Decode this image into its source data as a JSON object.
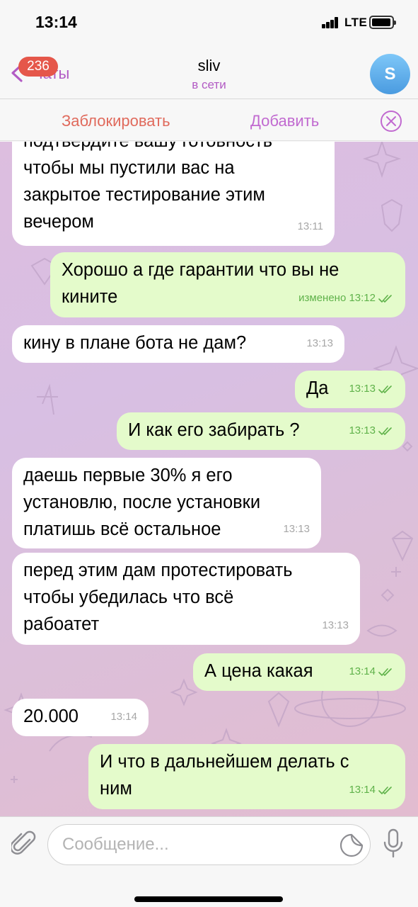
{
  "status_bar": {
    "time": "13:14",
    "network": "LTE"
  },
  "header": {
    "back_label": "Чаты",
    "unread_badge": "236",
    "title": "sliv",
    "subtitle": "в сети",
    "avatar_letter": "S"
  },
  "action_bar": {
    "block_label": "Заблокировать",
    "add_label": "Добавить"
  },
  "messages": [
    {
      "dir": "in",
      "text": "подтвердите вашу готовность\nчтобы мы пустили вас на\nзакрытое тестирование этим\nвечером",
      "time": "13:11"
    },
    {
      "dir": "out",
      "text": "Хорошо а где гарантии что вы не\nкините",
      "time": "изменено 13:12",
      "read": true
    },
    {
      "dir": "in",
      "text": "кину в плане бота не дам?",
      "time": "13:13"
    },
    {
      "dir": "out",
      "text": "Да",
      "time": "13:13",
      "read": true
    },
    {
      "dir": "out",
      "text": "И как его забирать ?",
      "time": "13:13",
      "read": true
    },
    {
      "dir": "in",
      "text": "даешь первые 30% я его\nустановлю, после установки\nплатишь всё остальное",
      "time": "13:13"
    },
    {
      "dir": "in",
      "text": "перед этим дам протестировать\nчтобы убедилась что всё\nрабоатет",
      "time": "13:13"
    },
    {
      "dir": "out",
      "text": "А цена какая",
      "time": "13:14",
      "read": true
    },
    {
      "dir": "in",
      "text": "20.000",
      "time": "13:14"
    },
    {
      "dir": "out",
      "text": "И что в дальнейшем делать с\nним",
      "time": "13:14",
      "read": true
    }
  ],
  "composer": {
    "placeholder": "Сообщение..."
  },
  "colors": {
    "accent": "#b25bc4",
    "outgoing_bubble": "#e4fbcb",
    "incoming_bubble": "#ffffff",
    "badge": "#e5574a",
    "block": "#e06a5c"
  }
}
